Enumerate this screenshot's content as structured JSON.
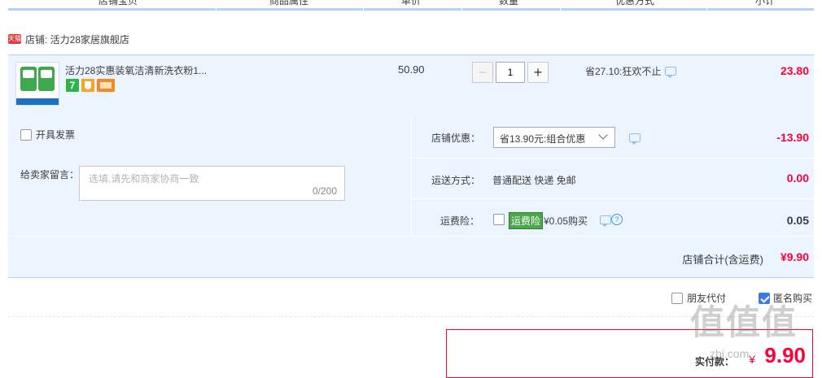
{
  "columns": [
    "店铺宝贝",
    "商品属性",
    "单价",
    "数量",
    "优惠方式",
    "小计"
  ],
  "shop": {
    "badge": "天猫",
    "label": "店铺: 活力28家居旗舰店"
  },
  "item": {
    "title": "活力28实惠装氧洁清新洗衣粉1...",
    "service_icons": [
      "seven-day-return-icon",
      "guarantee-shield-icon",
      "credit-card-icon"
    ],
    "unit_price": "50.90",
    "quantity": "1",
    "qty_minus": "−",
    "qty_plus": "+",
    "promotion": "省27.10:狂欢不止",
    "subtotal": "23.80"
  },
  "options": {
    "invoice_label": "开具发票",
    "message_label": "给卖家留言：",
    "message_placeholder": "选填,请先和商家协商一致",
    "message_count": "0/200",
    "shop_discount": {
      "label": "店铺优惠：",
      "selected": "省13.90元:组合优惠",
      "value": "-13.90"
    },
    "shipping": {
      "label": "运送方式：",
      "text": "普通配送 快递 免邮",
      "value": "0.00"
    },
    "insurance": {
      "label": "运费险：",
      "badge": "运费险",
      "text": "¥0.05购买",
      "value": "0.05",
      "help": "?"
    },
    "shop_total_label": "店铺合计(含运费)",
    "shop_total": "¥9.90"
  },
  "footer": {
    "friend_pay_label": "朋友代付",
    "anonymous_label": "匿名购买",
    "anonymous_checked": true,
    "actual_pay_label": "实付款：",
    "currency": "¥",
    "amount": "9.90"
  },
  "watermark": {
    "text": "值值值",
    "sub": "zhi.com"
  },
  "colors": {
    "accent_blue": "#b2d1ff",
    "row_bg": "#ecf4ff",
    "price_red": "#ff0036",
    "insurance_green": "#4aa84a"
  }
}
